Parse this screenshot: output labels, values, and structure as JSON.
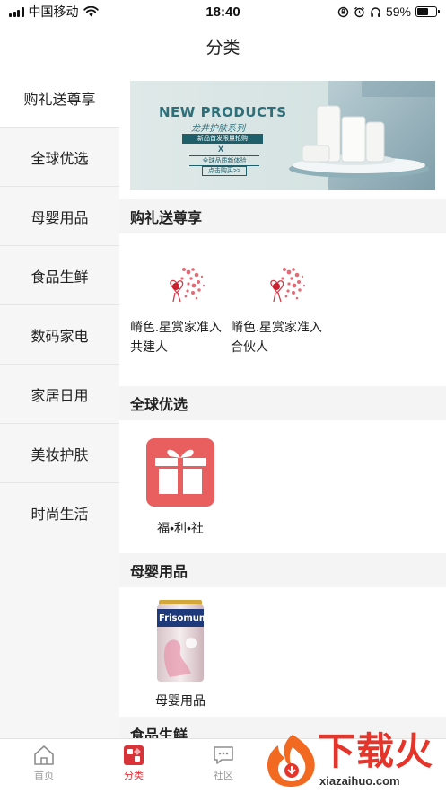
{
  "status_bar": {
    "carrier": "中国移动",
    "time": "18:40",
    "battery_text": "59%",
    "battery_level": 0.59
  },
  "header": {
    "title": "分类"
  },
  "sidebar": {
    "items": [
      {
        "label": "购礼送尊享",
        "active": true
      },
      {
        "label": "全球优选",
        "active": false
      },
      {
        "label": "母婴用品",
        "active": false
      },
      {
        "label": "食品生鲜",
        "active": false
      },
      {
        "label": "数码家电",
        "active": false
      },
      {
        "label": "家居日用",
        "active": false
      },
      {
        "label": "美妆护肤",
        "active": false
      },
      {
        "label": "时尚生活",
        "active": false
      }
    ]
  },
  "banner": {
    "headline": "NEW PRODUCTS",
    "subtitle": "龙井护肤系列",
    "tag1": "新品首发限量抢购",
    "cross": "X",
    "tag2": "全球品质新体验",
    "cta": "点击购买>>"
  },
  "sections": [
    {
      "title": "购礼送尊享",
      "items": [
        {
          "label_line1": "嵴色.星赏家准入",
          "label_line2": "共建人"
        },
        {
          "label_line1": "嵴色.星赏家准入",
          "label_line2": "合伙人"
        }
      ]
    },
    {
      "title": "全球优选",
      "items": [
        {
          "label": "福•利•社"
        }
      ]
    },
    {
      "title": "母婴用品",
      "items": [
        {
          "label": "母婴用品",
          "product_brand": "Frisomum"
        }
      ]
    },
    {
      "title": "食品生鲜"
    }
  ],
  "tabbar": {
    "tabs": [
      {
        "label": "首页",
        "icon": "home-icon",
        "active": false
      },
      {
        "label": "分类",
        "icon": "category-icon",
        "active": true
      },
      {
        "label": "社区",
        "icon": "chat-icon",
        "active": false
      }
    ]
  },
  "watermark": {
    "text": "下载火",
    "url": "xiazaihuo.com"
  },
  "colors": {
    "accent": "#d9333a",
    "gift_red": "#e95e5e",
    "sidebar_bg": "#f6f6f6",
    "section_bg": "#f4f4f4"
  }
}
